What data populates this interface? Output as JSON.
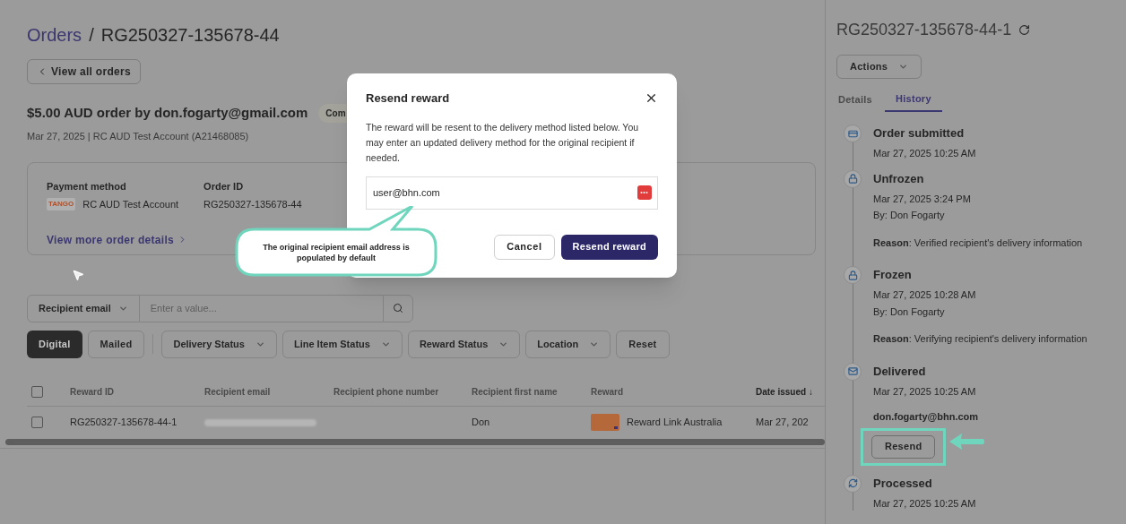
{
  "breadcrumb": {
    "parent": "Orders",
    "separator": "/",
    "current": "RG250327-135678-44"
  },
  "back_button": "View all orders",
  "order": {
    "title": "$5.00 AUD order by don.fogarty@gmail.com",
    "status": "Com",
    "subtitle": "Mar 27, 2025 | RC AUD Test Account (A21468085)"
  },
  "summary": {
    "fields": [
      {
        "label": "Payment method",
        "value": "RC AUD Test Account",
        "logo": "TANGO"
      },
      {
        "label": "Order ID",
        "value": "RG250327-135678-44"
      }
    ],
    "link": "View more order details"
  },
  "search": {
    "filter": "Recipient email",
    "placeholder": "Enter a value..."
  },
  "toggles": [
    {
      "label": "Digital",
      "selected": true
    },
    {
      "label": "Mailed",
      "selected": false
    }
  ],
  "filters": [
    "Delivery Status",
    "Line Item Status",
    "Reward Status",
    "Location"
  ],
  "reset": "Reset",
  "table": {
    "columns": [
      "Reward ID",
      "Recipient email",
      "Recipient phone number",
      "Recipient first name",
      "Reward",
      "Date issued ↓"
    ],
    "rows": [
      {
        "checked": false,
        "reward_id": "RG250327-135678-44-1",
        "first_name": "Don",
        "reward": "Reward Link Australia",
        "date": "Mar 27, 202"
      }
    ]
  },
  "header_checked": false,
  "modal": {
    "title": "Resend reward",
    "body": "The reward will be resent to the delivery method listed below. You may enter an updated delivery method for the original recipient if needed.",
    "value": "user@bhn.com",
    "cancel": "Cancel",
    "confirm": "Resend reward"
  },
  "callout": "The original recipient email address is populated by default",
  "panel": {
    "title": "RG250327-135678-44-1",
    "actions": "Actions",
    "tabs": [
      {
        "label": "Details",
        "selected": false
      },
      {
        "label": "History",
        "selected": true
      }
    ],
    "history": [
      {
        "kind": "card",
        "title": "Order submitted",
        "date": "Mar 27, 2025 10:25 AM"
      },
      {
        "kind": "lock",
        "title": "Unfrozen",
        "date": "Mar 27, 2025 3:24 PM",
        "by": "By: Don Fogarty",
        "reason": "**Reason**: Verified recipient's delivery information"
      },
      {
        "kind": "lock",
        "title": "Frozen",
        "date": "Mar 27, 2025 10:28 AM",
        "by": "By: Don Fogarty",
        "reason": "**Reason**: Verifying recipient's delivery information"
      },
      {
        "kind": "mail",
        "title": "Delivered",
        "date": "Mar 27, 2025 10:25 AM",
        "email": "don.fogarty@bhn.com",
        "button": "Resend"
      },
      {
        "kind": "sync",
        "title": "Processed",
        "date": "Mar 27, 2025 10:25 AM"
      }
    ]
  }
}
